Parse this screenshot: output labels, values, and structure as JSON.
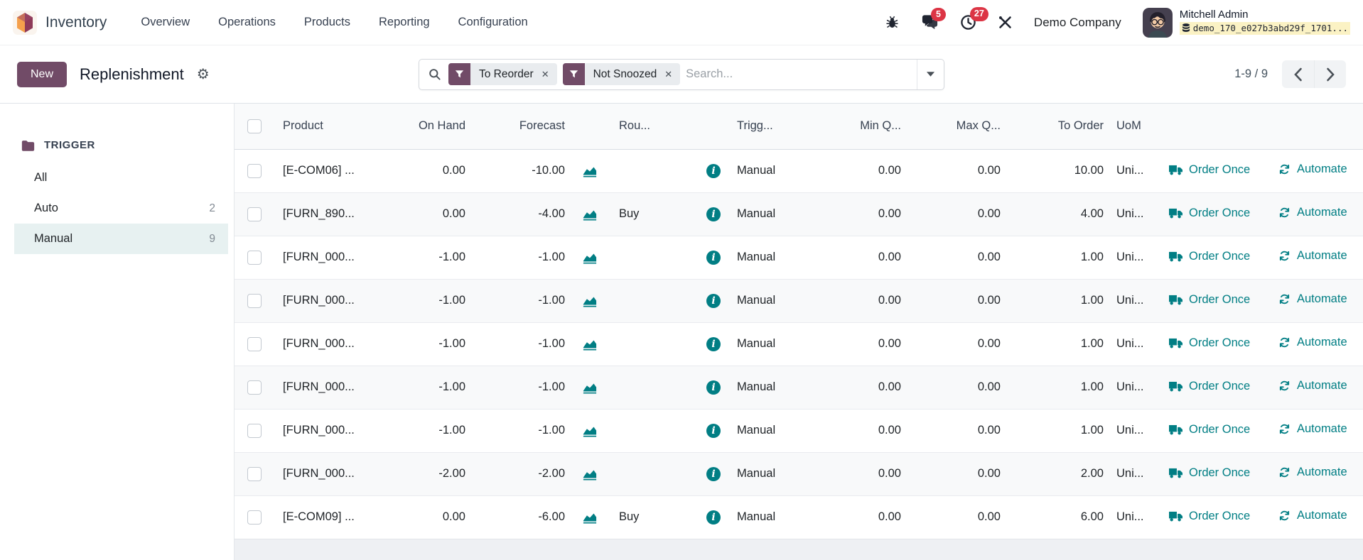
{
  "colors": {
    "accent_purple": "#714B67",
    "accent_teal": "#017E84",
    "badge_red": "#DC3545",
    "selected_filter_bg": "#E7F1F1",
    "db_highlight_yellow": "#FBF2C4"
  },
  "icons": {
    "gear": "⚙",
    "close": "✕"
  },
  "navbar": {
    "app_name": "Inventory",
    "menu_items": [
      {
        "label": "Overview"
      },
      {
        "label": "Operations"
      },
      {
        "label": "Products"
      },
      {
        "label": "Reporting"
      },
      {
        "label": "Configuration"
      }
    ],
    "messages_badge": "5",
    "activities_badge": "27",
    "company": "Demo Company",
    "user_name": "Mitchell Admin",
    "database": "demo_170_e027b3abd29f_1701..."
  },
  "control_panel": {
    "new_button": "New",
    "title": "Replenishment",
    "search": {
      "placeholder": "Search...",
      "filters": [
        {
          "label": "To Reorder"
        },
        {
          "label": "Not Snoozed"
        }
      ]
    },
    "pager": {
      "text": "1-9 / 9"
    }
  },
  "sidebar": {
    "section": "TRIGGER",
    "items": [
      {
        "label": "All",
        "count": ""
      },
      {
        "label": "Auto",
        "count": "2"
      },
      {
        "label": "Manual",
        "count": "9",
        "selected": true
      }
    ]
  },
  "table": {
    "headers": {
      "product": "Product",
      "on_hand": "On Hand",
      "forecast": "Forecast",
      "route": "Rou...",
      "trigger": "Trigg...",
      "min_qty": "Min Q...",
      "max_qty": "Max Q...",
      "to_order": "To Order",
      "uom": "UoM"
    },
    "order_once_label": "Order Once",
    "automate_label": "Automate",
    "rows": [
      {
        "product": "[E-COM06] ...",
        "on_hand": "0.00",
        "forecast": "-10.00",
        "route": "",
        "trigger": "Manual",
        "min_qty": "0.00",
        "max_qty": "0.00",
        "to_order": "10.00",
        "uom": "Uni..."
      },
      {
        "product": "[FURN_890...",
        "on_hand": "0.00",
        "forecast": "-4.00",
        "route": "Buy",
        "trigger": "Manual",
        "min_qty": "0.00",
        "max_qty": "0.00",
        "to_order": "4.00",
        "uom": "Uni..."
      },
      {
        "product": "[FURN_000...",
        "on_hand": "-1.00",
        "forecast": "-1.00",
        "route": "",
        "trigger": "Manual",
        "min_qty": "0.00",
        "max_qty": "0.00",
        "to_order": "1.00",
        "uom": "Uni..."
      },
      {
        "product": "[FURN_000...",
        "on_hand": "-1.00",
        "forecast": "-1.00",
        "route": "",
        "trigger": "Manual",
        "min_qty": "0.00",
        "max_qty": "0.00",
        "to_order": "1.00",
        "uom": "Uni..."
      },
      {
        "product": "[FURN_000...",
        "on_hand": "-1.00",
        "forecast": "-1.00",
        "route": "",
        "trigger": "Manual",
        "min_qty": "0.00",
        "max_qty": "0.00",
        "to_order": "1.00",
        "uom": "Uni..."
      },
      {
        "product": "[FURN_000...",
        "on_hand": "-1.00",
        "forecast": "-1.00",
        "route": "",
        "trigger": "Manual",
        "min_qty": "0.00",
        "max_qty": "0.00",
        "to_order": "1.00",
        "uom": "Uni..."
      },
      {
        "product": "[FURN_000...",
        "on_hand": "-1.00",
        "forecast": "-1.00",
        "route": "",
        "trigger": "Manual",
        "min_qty": "0.00",
        "max_qty": "0.00",
        "to_order": "1.00",
        "uom": "Uni..."
      },
      {
        "product": "[FURN_000...",
        "on_hand": "-2.00",
        "forecast": "-2.00",
        "route": "",
        "trigger": "Manual",
        "min_qty": "0.00",
        "max_qty": "0.00",
        "to_order": "2.00",
        "uom": "Uni..."
      },
      {
        "product": "[E-COM09] ...",
        "on_hand": "0.00",
        "forecast": "-6.00",
        "route": "Buy",
        "trigger": "Manual",
        "min_qty": "0.00",
        "max_qty": "0.00",
        "to_order": "6.00",
        "uom": "Uni..."
      }
    ]
  }
}
